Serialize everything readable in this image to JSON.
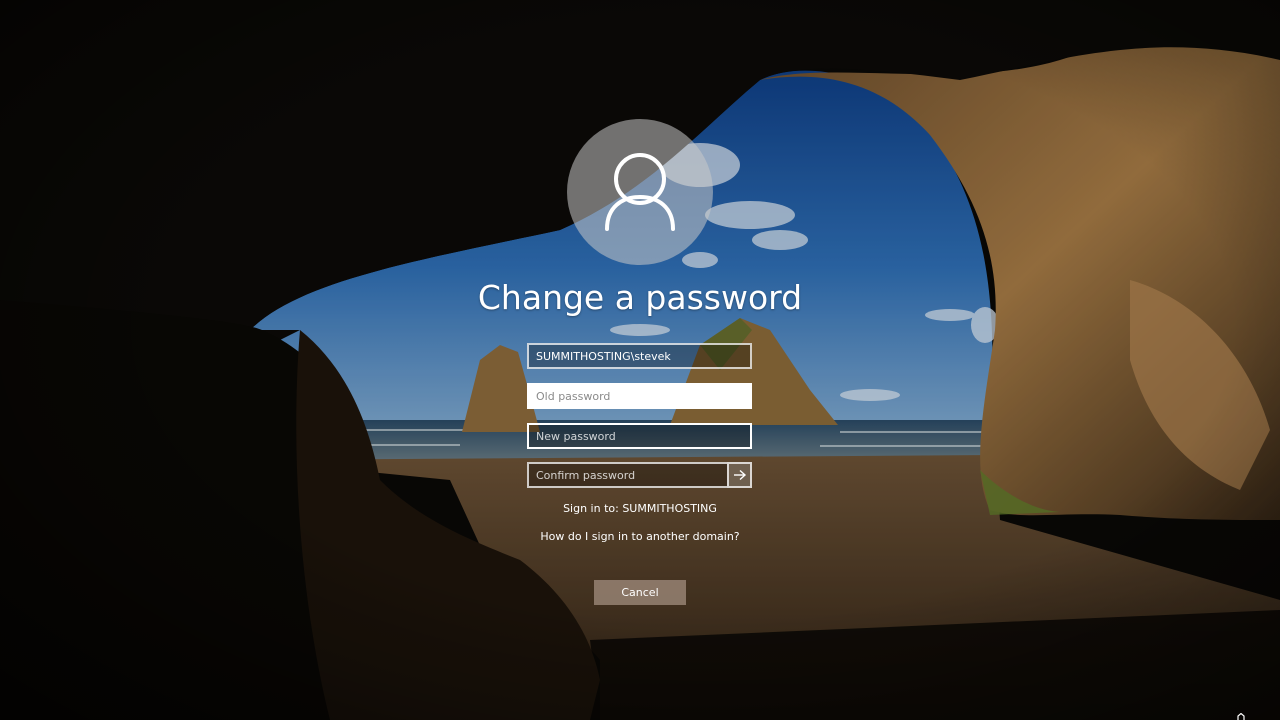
{
  "lockscreen": {
    "title": "Change a password",
    "username_value": "SUMMITHOSTING\\stevek",
    "old_password_placeholder": "Old password",
    "new_password_placeholder": "New password",
    "confirm_password_placeholder": "Confirm password",
    "sign_in_to": "Sign in to: SUMMITHOSTING",
    "other_domain_link": "How do I sign in to another domain?",
    "cancel_label": "Cancel",
    "avatar_icon": "user-icon",
    "submit_icon": "arrow-right-icon",
    "corner_icon": "accessibility-icon"
  },
  "colors": {
    "text": "#ffffff",
    "cancel_button": "#96826f",
    "field_border": "#ffffff"
  }
}
